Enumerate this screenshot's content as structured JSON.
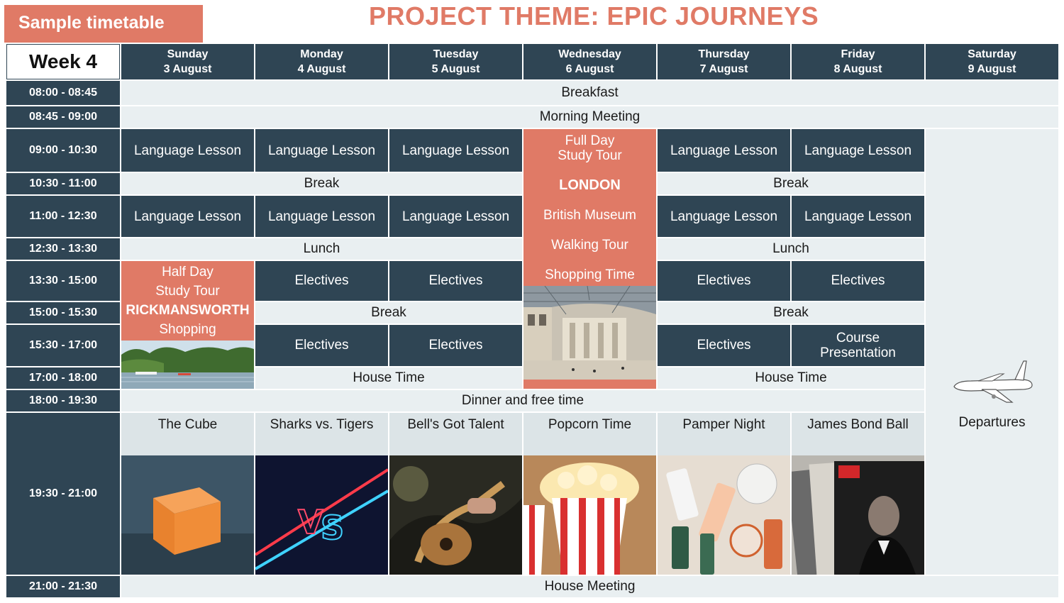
{
  "header": {
    "badge": "Sample timetable",
    "title": "PROJECT THEME: EPIC JOURNEYS"
  },
  "table": {
    "week": "Week 4",
    "days": [
      {
        "name": "Sunday",
        "date": "3 August"
      },
      {
        "name": "Monday",
        "date": "4 August"
      },
      {
        "name": "Tuesday",
        "date": "5 August"
      },
      {
        "name": "Wednesday",
        "date": "6 August"
      },
      {
        "name": "Thursday",
        "date": "7 August"
      },
      {
        "name": "Friday",
        "date": "8 August"
      },
      {
        "name": "Saturday",
        "date": "9 August"
      }
    ],
    "times": [
      "08:00 - 08:45",
      "08:45 - 09:00",
      "09:00 - 10:30",
      "10:30 - 11:00",
      "11:00 - 12:30",
      "12:30 - 13:30",
      "13:30 - 15:00",
      "15:00 - 15:30",
      "15:30 - 17:00",
      "17:00 - 18:00",
      "18:00 - 19:30",
      "19:30 - 21:00",
      "21:00 - 21:30"
    ],
    "breakfast": "Breakfast",
    "morning_meeting": "Morning Meeting",
    "language_lesson": "Language Lesson",
    "break": "Break",
    "lunch": "Lunch",
    "electives": "Electives",
    "house_time": "House Time",
    "dinner": "Dinner and free time",
    "house_meeting": "House Meeting",
    "course_presentation": "Course Presentation",
    "sunday_tour": {
      "line1": "Half Day",
      "line2": "Study Tour",
      "place": "RICKMANSWORTH",
      "activity": "Shopping"
    },
    "wednesday_tour": {
      "line1": "Full Day",
      "line2": "Study Tour",
      "place": "LONDON",
      "items": [
        "British Museum",
        "Walking Tour",
        "Shopping Time"
      ]
    },
    "evening": [
      "The Cube",
      "Sharks vs. Tigers",
      "Bell's Got Talent",
      "Popcorn Time",
      "Pamper Night",
      "James Bond Ball"
    ],
    "departures": "Departures"
  },
  "colors": {
    "navy": "#2f4554",
    "coral": "#e07a66",
    "light": "#e9eff1"
  }
}
